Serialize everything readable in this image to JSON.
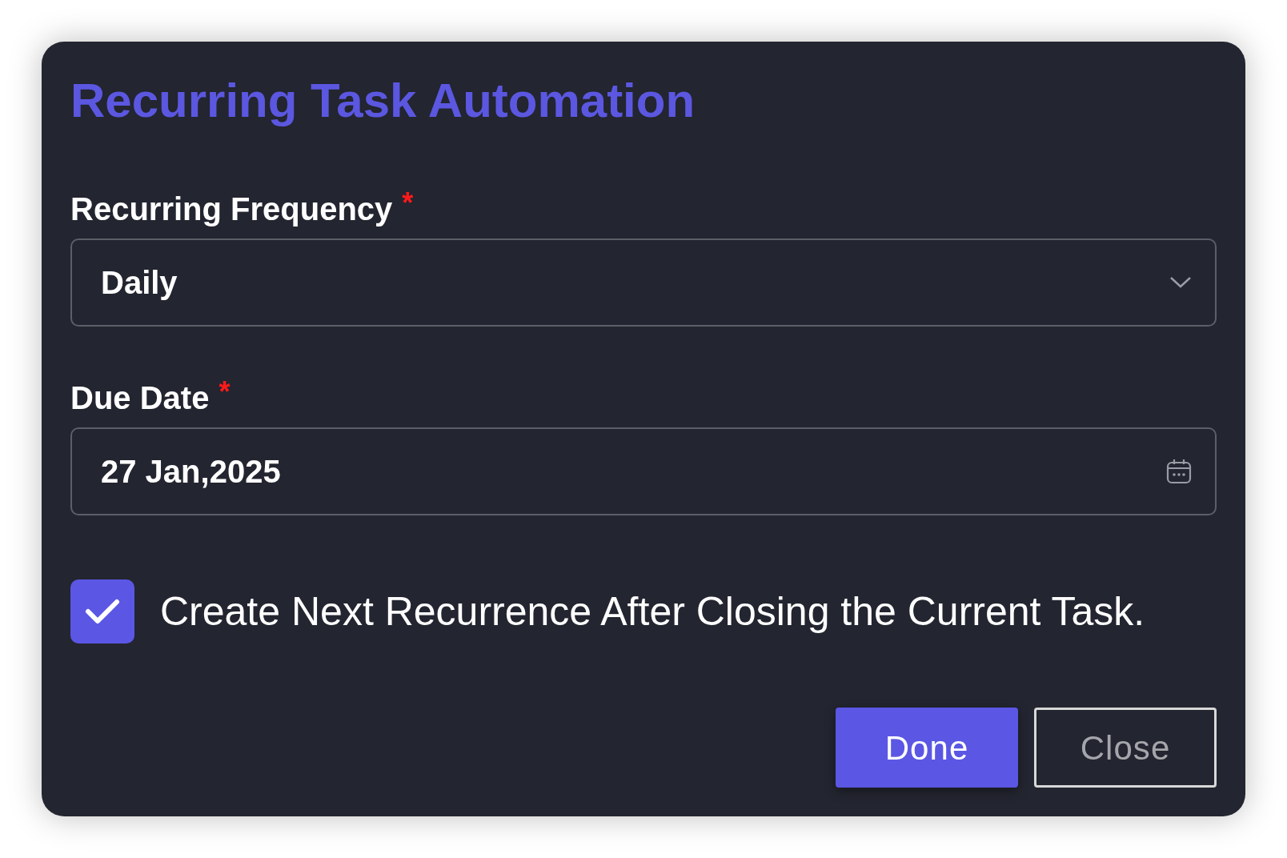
{
  "dialog": {
    "title": "Recurring Task Automation",
    "fields": [
      {
        "kind": "select",
        "label": "Recurring Frequency",
        "required_mark": "*",
        "value": "Daily"
      },
      {
        "kind": "date",
        "label": "Due Date",
        "required_mark": "*",
        "value": "27 Jan,2025"
      }
    ],
    "checkbox": {
      "label": "Create Next Recurrence After Closing the Current Task.",
      "checked": true
    },
    "buttons": [
      {
        "kind": "primary",
        "label": "Done"
      },
      {
        "kind": "outline",
        "label": "Close"
      }
    ]
  }
}
